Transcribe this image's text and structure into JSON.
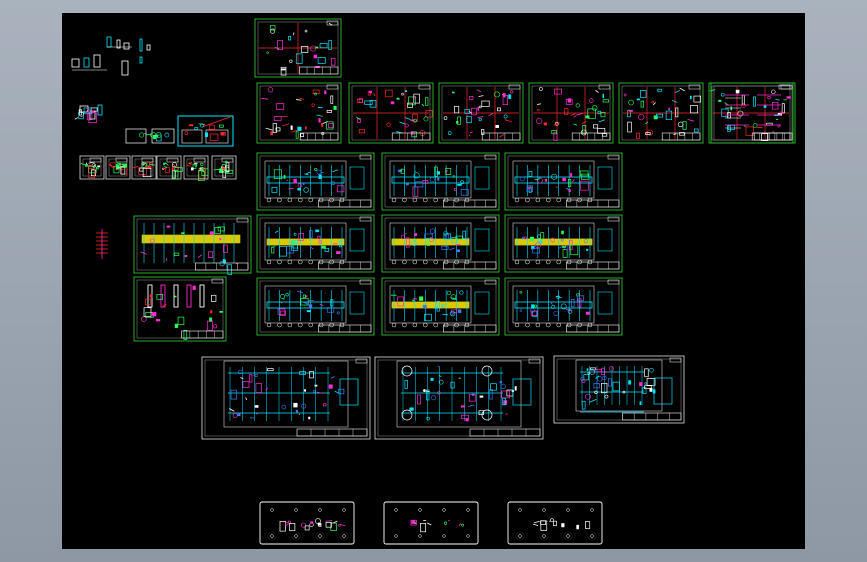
{
  "viewer": {
    "background_color": "#000000",
    "frame_color": "#98a2ae"
  },
  "palette": {
    "sheet_border": "#29c42e",
    "title_block": "#ffffff",
    "cyan": "#00e5ff",
    "magenta": "#ff2bd6",
    "yellow": "#ffee00",
    "red": "#ff2a2a",
    "green": "#2bff5a",
    "blue": "#3a7cff",
    "white": "#ffffff"
  },
  "sheets_top_row": [
    {
      "id": "sheet-a1",
      "kind": "detail-grid"
    },
    {
      "id": "sheet-a2",
      "kind": "detail-grid"
    },
    {
      "id": "sheet-a3",
      "kind": "detail-grid"
    },
    {
      "id": "sheet-a4",
      "kind": "detail-grid"
    },
    {
      "id": "sheet-a5",
      "kind": "detail-grid"
    },
    {
      "id": "sheet-a6",
      "kind": "detail-grid"
    },
    {
      "id": "sheet-a7",
      "kind": "text-notes"
    }
  ],
  "plan_sheets": [
    {
      "id": "plan-1",
      "band": "cyan"
    },
    {
      "id": "plan-2",
      "band": "cyan"
    },
    {
      "id": "plan-3",
      "band": "cyan"
    },
    {
      "id": "plan-4",
      "band": "yellow"
    },
    {
      "id": "plan-5",
      "band": "yellow"
    },
    {
      "id": "plan-6",
      "band": "yellow"
    },
    {
      "id": "plan-7",
      "band": "cyan"
    },
    {
      "id": "plan-8",
      "band": "yellow"
    },
    {
      "id": "plan-9",
      "band": "cyan"
    }
  ],
  "large_sheets": [
    {
      "id": "large-1"
    },
    {
      "id": "large-2"
    },
    {
      "id": "large-3"
    }
  ],
  "bottom_plates": [
    {
      "id": "plate-1"
    },
    {
      "id": "plate-2"
    },
    {
      "id": "plate-3"
    }
  ]
}
